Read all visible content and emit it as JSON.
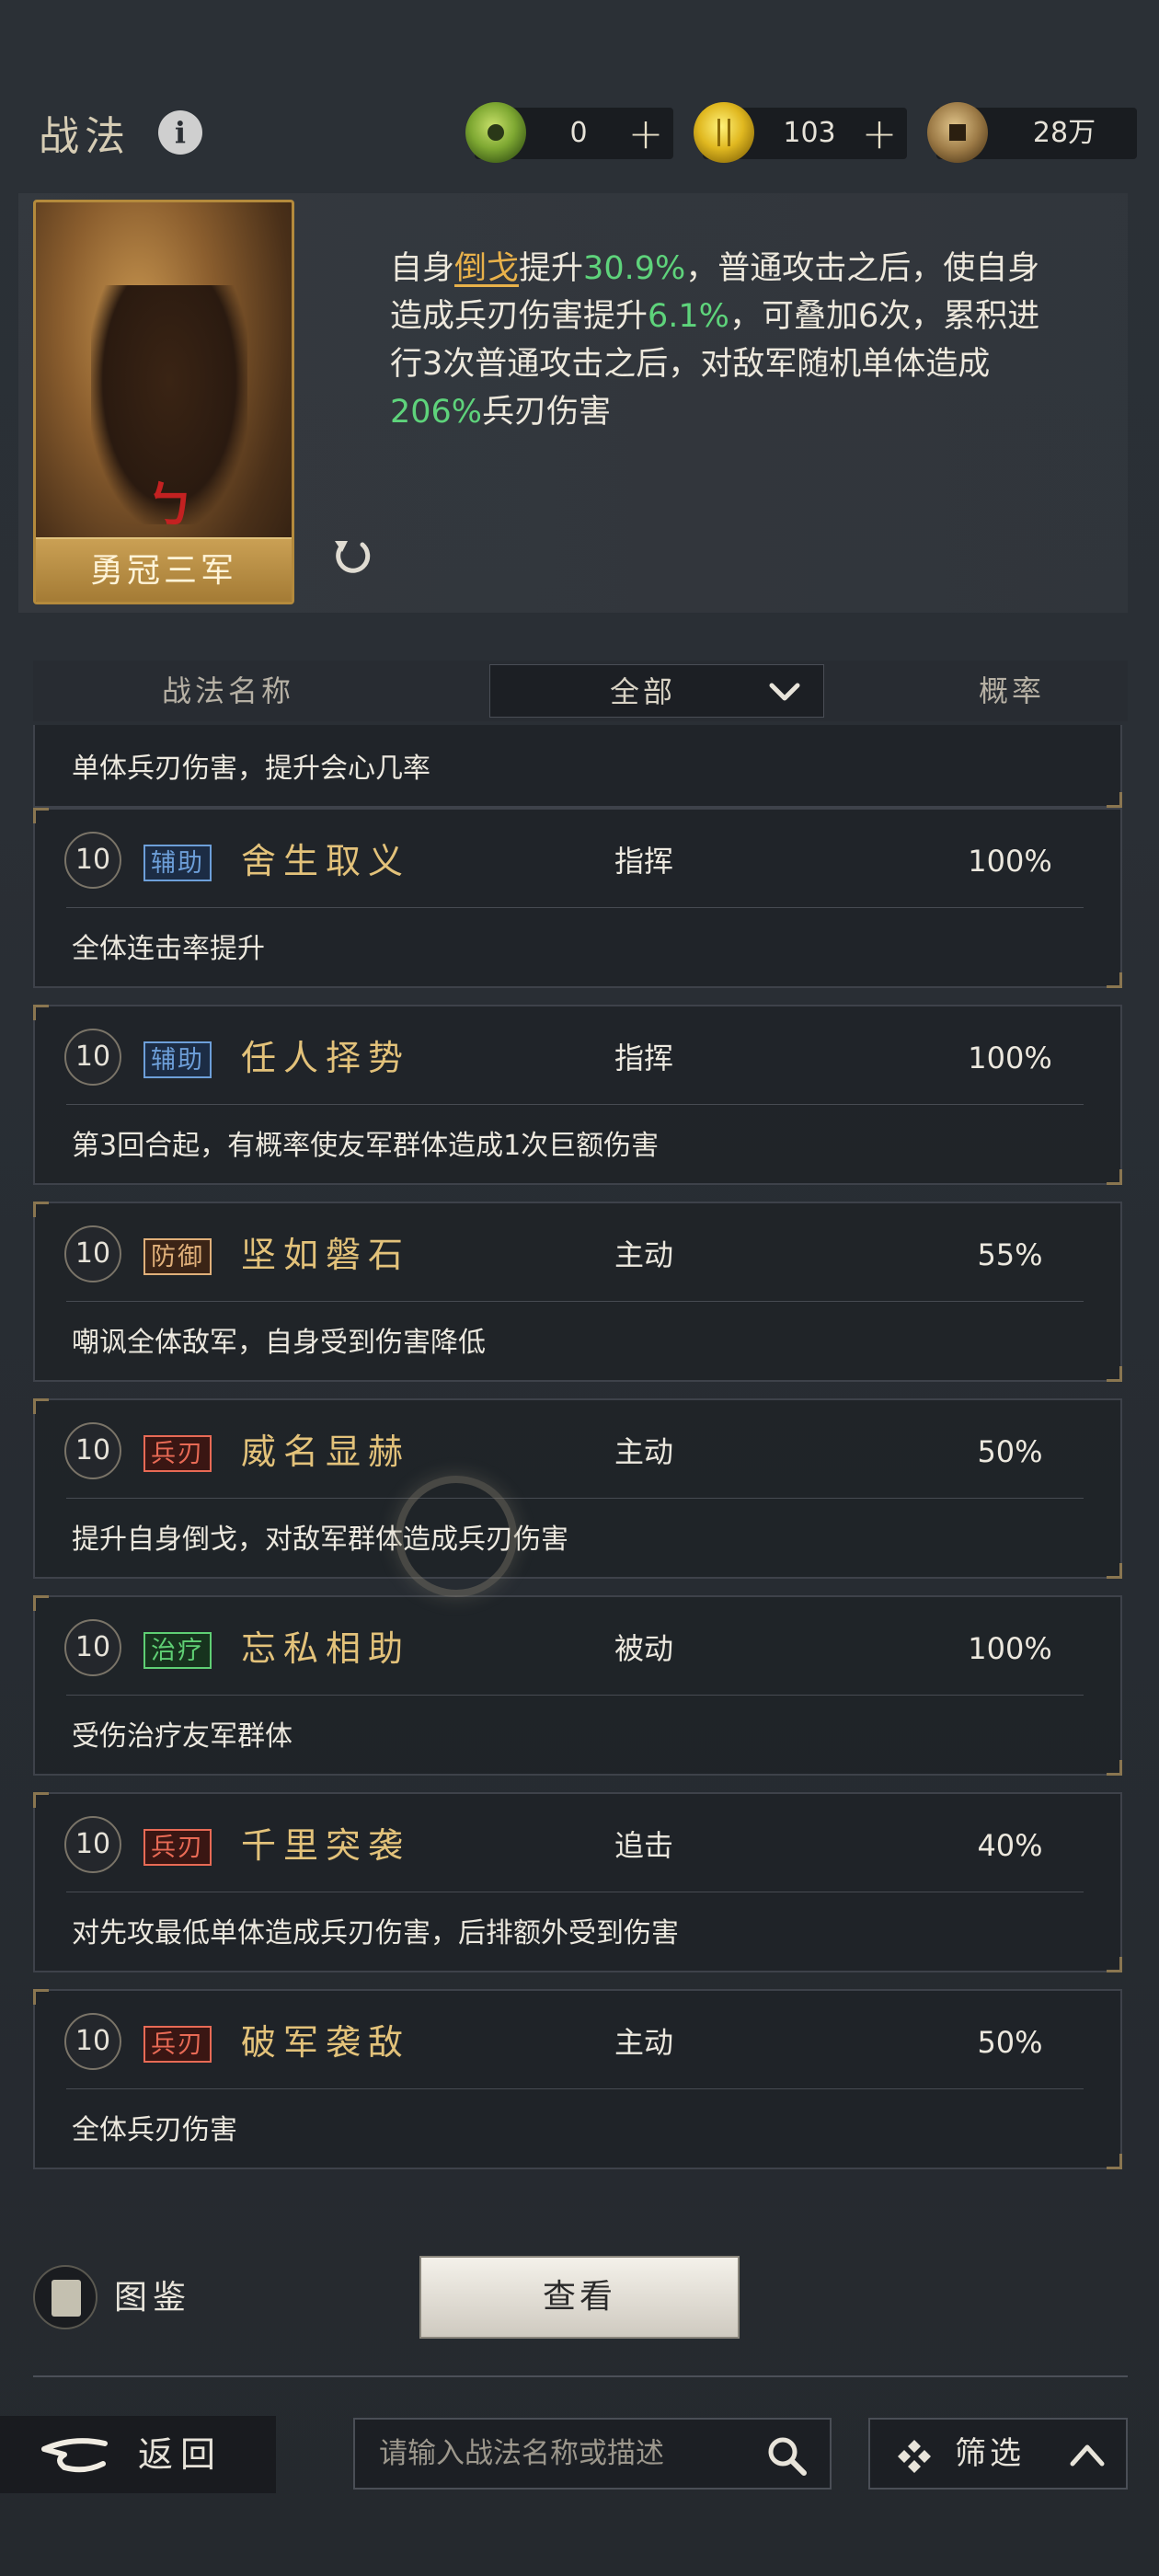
{
  "header": {
    "title": "战法",
    "resources": [
      {
        "icon": "jade-coin-icon",
        "value": "0",
        "plus": "+"
      },
      {
        "icon": "gold-coin-icon",
        "value": "103",
        "plus": "+"
      },
      {
        "icon": "copper-coin-icon",
        "value": "28万"
      }
    ]
  },
  "card": {
    "name": "勇冠三军",
    "description": {
      "p1": "自身",
      "h1": "倒戈",
      "p2": "提升",
      "h2": "30.9%",
      "p3": "，普通攻击之后，使自身造成兵刃伤害提升",
      "h3": "6.1%",
      "p4": "，可叠加6次，累积进行3次普通攻击之后，对敌军随机单体造成",
      "h4": "206%",
      "p5": "兵刃伤害"
    }
  },
  "columns": {
    "name": "战法名称",
    "filter": "全部",
    "rate": "概率"
  },
  "partial_row_note": "单体兵刃伤害，提升会心几率",
  "rows": [
    {
      "level": "10",
      "tag": "辅助",
      "name": "舍生取义",
      "type": "指挥",
      "rate": "100%",
      "note": "全体连击率提升"
    },
    {
      "level": "10",
      "tag": "辅助",
      "name": "任人择势",
      "type": "指挥",
      "rate": "100%",
      "note": "第3回合起，有概率使友军群体造成1次巨额伤害"
    },
    {
      "level": "10",
      "tag": "防御",
      "name": "坚如磐石",
      "type": "主动",
      "rate": "55%",
      "note": "嘲讽全体敌军，自身受到伤害降低"
    },
    {
      "level": "10",
      "tag": "兵刃",
      "name": "威名显赫",
      "type": "主动",
      "rate": "50%",
      "note": "提升自身倒戈，对敌军群体造成兵刃伤害"
    },
    {
      "level": "10",
      "tag": "治疗",
      "name": "忘私相助",
      "type": "被动",
      "rate": "100%",
      "note": "受伤治疗友军群体"
    },
    {
      "level": "10",
      "tag": "兵刃",
      "name": "千里突袭",
      "type": "追击",
      "rate": "40%",
      "note": "对先攻最低单体造成兵刃伤害，后排额外受到伤害"
    },
    {
      "level": "10",
      "tag": "兵刃",
      "name": "破军袭敌",
      "type": "主动",
      "rate": "50%",
      "note": "全体兵刃伤害"
    }
  ],
  "bottom": {
    "atlas_label": "图鉴",
    "view_button": "查看",
    "back_label": "返回",
    "search_placeholder": "请输入战法名称或描述",
    "filter_label": "筛选"
  },
  "colors": {
    "highlight_gold": "#e8b14a",
    "highlight_green": "#5ed37b",
    "skill_name_gold": "#e3c27a"
  }
}
